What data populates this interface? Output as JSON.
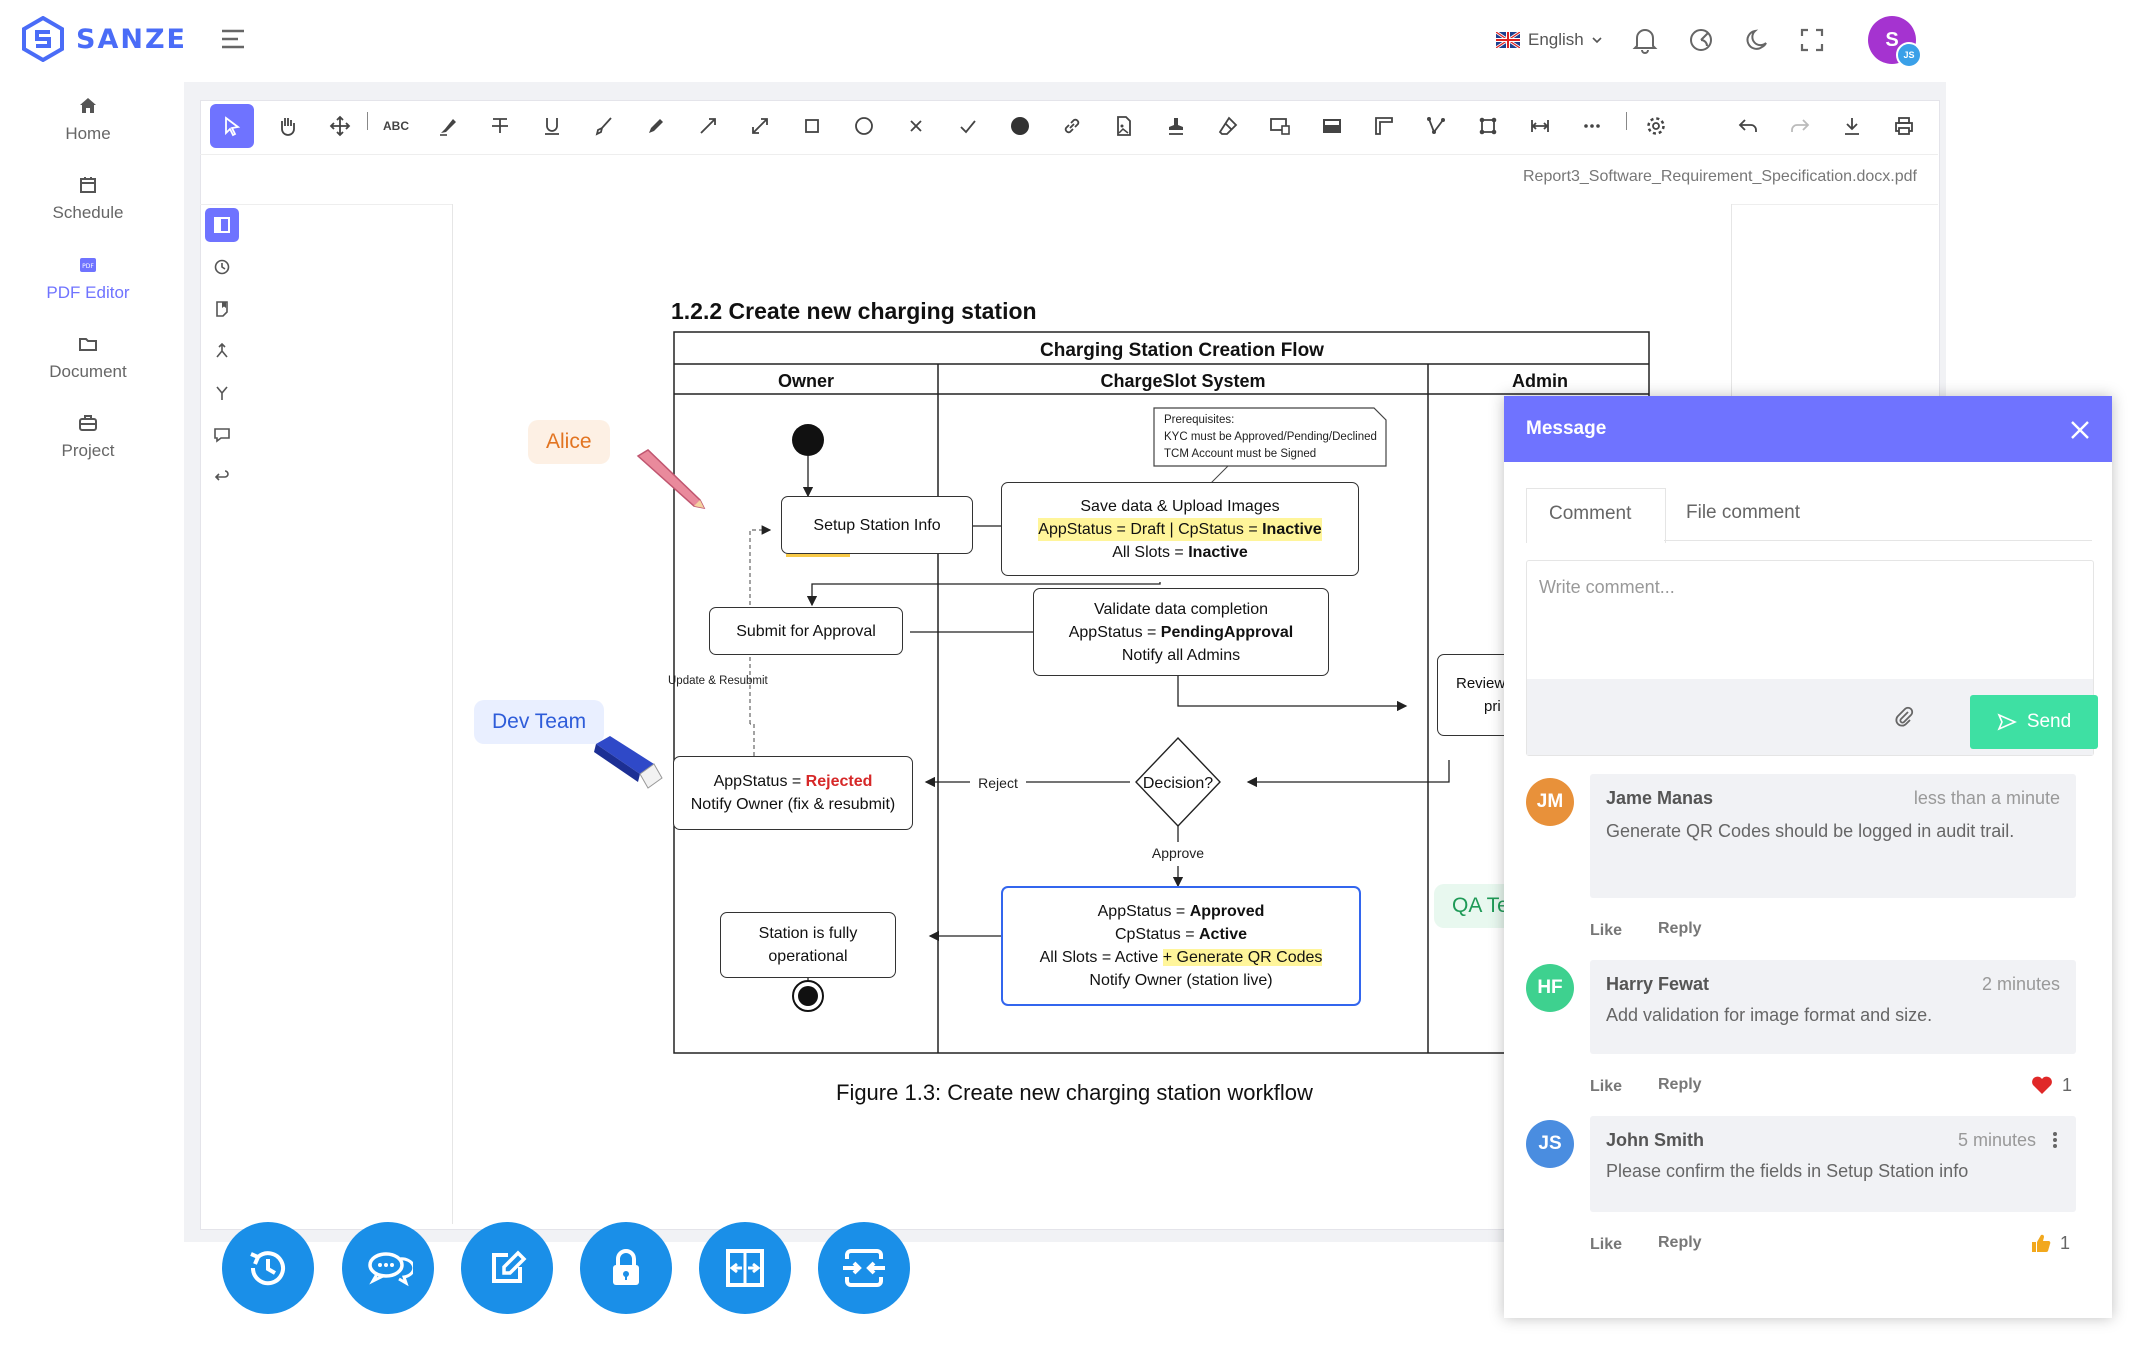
{
  "brand": {
    "name": "SANZE",
    "color": "#4a6cf7"
  },
  "sidebar": {
    "items": [
      {
        "label": "Home",
        "icon": "home-icon"
      },
      {
        "label": "Schedule",
        "icon": "calendar-icon"
      },
      {
        "label": "PDF Editor",
        "icon": "pdf-icon",
        "active": true
      },
      {
        "label": "Document",
        "icon": "folder-icon"
      },
      {
        "label": "Project",
        "icon": "briefcase-icon"
      }
    ],
    "pdf_icon_text": "PDF"
  },
  "header": {
    "language": "English",
    "avatar_initial": "S",
    "avatar_badge": "JS"
  },
  "editor": {
    "filename": "Report3_Software_Requirement_Specification.docx.pdf",
    "toolbar_text_tool": "ABC"
  },
  "document": {
    "section_title": "1.2.2 Create new charging station",
    "diagram_title": "Charging Station Creation Flow",
    "lanes": [
      "Owner",
      "ChargeSlot System",
      "Admin"
    ],
    "note_lines": [
      "Prerequisites:",
      "KYC must be Approved/Pending/Declined",
      "TCM Account must be Signed"
    ],
    "setup_station": "Setup Station Info",
    "save_data": {
      "line1": "Save data & Upload Images",
      "l2a": "AppStatus = Draft | CpStatus = ",
      "l2b": "Inactive",
      "l3a": "All Slots = ",
      "l3b": "Inactive"
    },
    "submit_approval": "Submit for Approval",
    "validate": {
      "line1": "Validate data completion",
      "l2a": "AppStatus = ",
      "l2b": "PendingApproval",
      "line3": "Notify all Admins"
    },
    "review": {
      "line1": "Review",
      "line2": "pri"
    },
    "update_resubmit": "Update & Resubmit",
    "rejected": {
      "l1a": "AppStatus = ",
      "l1b": "Rejected",
      "line2": "Notify Owner (fix & resubmit)"
    },
    "reject_label": "Reject",
    "decision": "Decision?",
    "approve_label": "Approve",
    "approved": {
      "l1a": "AppStatus = ",
      "l1b": "Approved",
      "l2a": "CpStatus = ",
      "l2b": "Active",
      "l3a": "All Slots = Active ",
      "l3b": "+ Generate QR Codes",
      "line4": "Notify Owner (station live)"
    },
    "operational": {
      "line1": "Station is fully",
      "line2": "operational"
    },
    "caption": "Figure 1.3: Create new charging station workflow",
    "tags": {
      "alice": "Alice",
      "dev_team": "Dev Team",
      "qa": "QA Te"
    }
  },
  "message_panel": {
    "title": "Message",
    "tabs": [
      "Comment",
      "File comment"
    ],
    "placeholder": "Write comment...",
    "send_label": "Send",
    "comments": [
      {
        "initials": "JM",
        "name": "Jame Manas",
        "time": "less than a minute",
        "text": "Generate QR Codes should be logged in audit trail.",
        "color": "#e8913a",
        "like": "Like",
        "reply": "Reply",
        "reaction": "",
        "count": ""
      },
      {
        "initials": "HF",
        "name": "Harry Fewat",
        "time": "2 minutes",
        "text": "Add validation for image format  and size.",
        "color": "#3ed18f",
        "like": "Like",
        "reply": "Reply",
        "reaction": "heart",
        "count": "1"
      },
      {
        "initials": "JS",
        "name": "John Smith",
        "time": "5 minutes",
        "text": "Please confirm the fields in Setup Station info",
        "color": "#4a8de0",
        "like": "Like",
        "reply": "Reply",
        "reaction": "thumbs-up",
        "count": "1"
      }
    ]
  },
  "bottom_actions": [
    "history-icon",
    "chat-icon",
    "edit-icon",
    "lock-icon",
    "compare-icon",
    "merge-icon"
  ],
  "colors": {
    "accent": "#6f73ff",
    "action_blue": "#1a8fe8",
    "send_green": "#3ee0a3"
  }
}
